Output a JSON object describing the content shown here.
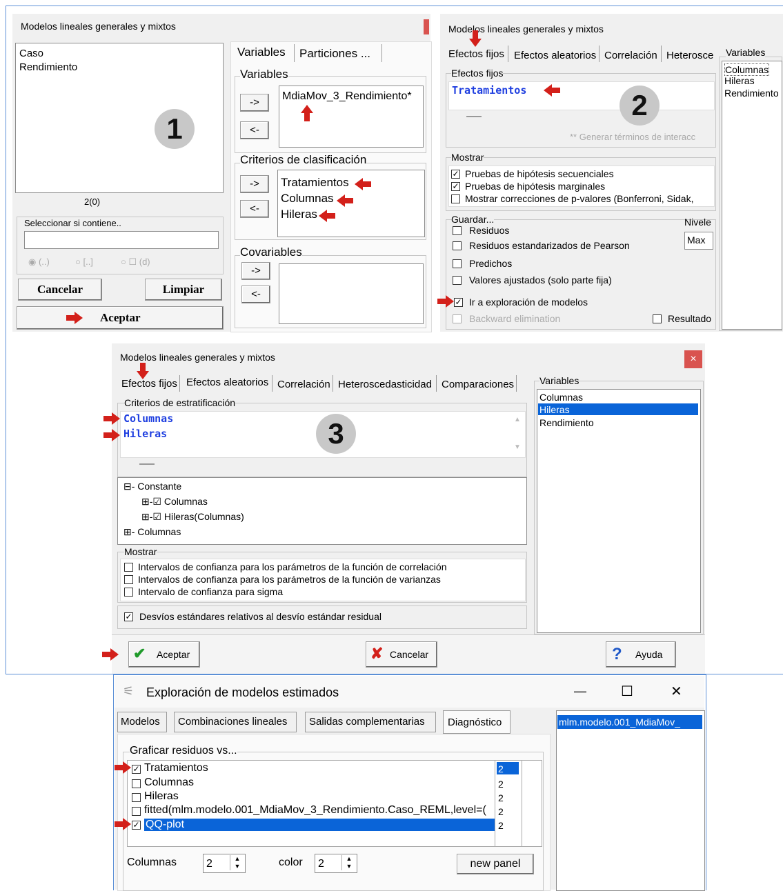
{
  "colors": {
    "accent_red": "#d3201a",
    "link_blue": "#1f3fe0",
    "selection": "#0a64d8",
    "badge": "#c8c8c8"
  },
  "icons": [
    "red-arrow-icon",
    "checkmark-icon",
    "x-cancel-icon",
    "question-icon",
    "app-icon",
    "minimize-icon",
    "maximize-icon",
    "close-icon",
    "spinner-icon",
    "tree-expand-icon"
  ],
  "p1": {
    "title": "Modelos lineales generales y mixtos",
    "list": [
      "Caso",
      "Rendimiento"
    ],
    "count": "2(0)",
    "filter_label": "Seleccionar si contiene..",
    "radio_labels": [
      "(..)",
      "[..]",
      "(d)"
    ],
    "cancel": "Cancelar",
    "clear": "Limpiar",
    "accept": "Aceptar",
    "badge": "1",
    "tabs": [
      "Variables",
      "Particiones ..."
    ],
    "variables_label": "Variables",
    "variables_value": "MdiaMov_3_Rendimiento*",
    "criteria_label": "Criterios de clasificación",
    "criteria": [
      "Tratamientos",
      "Columnas",
      "Hileras"
    ],
    "covariates_label": "Covariables",
    "arrow_right": "->",
    "arrow_left": "<-"
  },
  "p2": {
    "title": "Modelos lineales generales y mixtos",
    "tabs": [
      "Efectos fijos",
      "Efectos aleatorios",
      "Correlación",
      "Heterosce"
    ],
    "fixed_label": "Efectos fijos",
    "fixed_value": "Tratamientos",
    "badge": "2",
    "interaction": "Generar términos de interacc",
    "show_label": "Mostrar",
    "show": [
      "Pruebas de hipótesis secuenciales",
      "Pruebas de hipótesis marginales",
      "Mostrar correcciones de p-valores (Bonferroni, Sidak,"
    ],
    "save_label": "Guardar...",
    "save": [
      "Residuos",
      "Residuos estandarizados de Pearson",
      "Predichos",
      "Valores ajustados (solo parte fija)"
    ],
    "level_label": "Nivele",
    "level_value": "Max",
    "explore": "Ir a exploración de modelos",
    "backward": "Backward elimination",
    "result": "Resultado",
    "vars_label": "Variables",
    "vars": [
      "Columnas",
      "Hileras",
      "Rendimiento"
    ]
  },
  "p3": {
    "title": "Modelos lineales generales y mixtos",
    "close": "×",
    "tabs": [
      "Efectos fijos",
      "Efectos aleatorios",
      "Correlación",
      "Heteroscedasticidad",
      "Comparaciones"
    ],
    "strat_label": "Criterios de estratificación",
    "strat": [
      "Columnas",
      "Hileras"
    ],
    "badge": "3",
    "tree": [
      "Constante",
      "Columnas",
      "Hileras(Columnas)",
      "Columnas"
    ],
    "show_label": "Mostrar",
    "show": [
      "Intervalos de confianza para los parámetros de la función de correlación",
      "Intervalos de confianza para los parámetros de la función de varianzas",
      "Intervalo de confianza para sigma"
    ],
    "relative_sd": "Desvíos estándares relativos al desvío estándar residual",
    "vars_label": "Variables",
    "vars": [
      "Columnas",
      "Hileras",
      "Rendimiento"
    ],
    "accept": "Aceptar",
    "cancel": "Cancelar",
    "help": "Ayuda"
  },
  "p4": {
    "title": "Exploración de modelos estimados",
    "tabs": [
      "Modelos",
      "Combinaciones lineales",
      "Salidas complementarias",
      "Diagnóstico"
    ],
    "model_item": "mlm.modelo.001_MdiaMov_",
    "group_label": "Graficar residuos vs...",
    "items": [
      "Tratamientos",
      "Columnas",
      "Hileras",
      "fitted(mlm.modelo.001_MdiaMov_3_Rendimiento.Caso_REML,level=(",
      "QQ-plot"
    ],
    "item_checked": [
      true,
      false,
      false,
      false,
      true
    ],
    "side_values": [
      "2",
      "2",
      "2",
      "2",
      "2"
    ],
    "cols_label": "Columnas",
    "cols_value": "2",
    "color_label": "color",
    "color_value": "2",
    "new_panel": "new panel",
    "win_min": "—",
    "win_max": "☐",
    "win_close": "✕"
  }
}
